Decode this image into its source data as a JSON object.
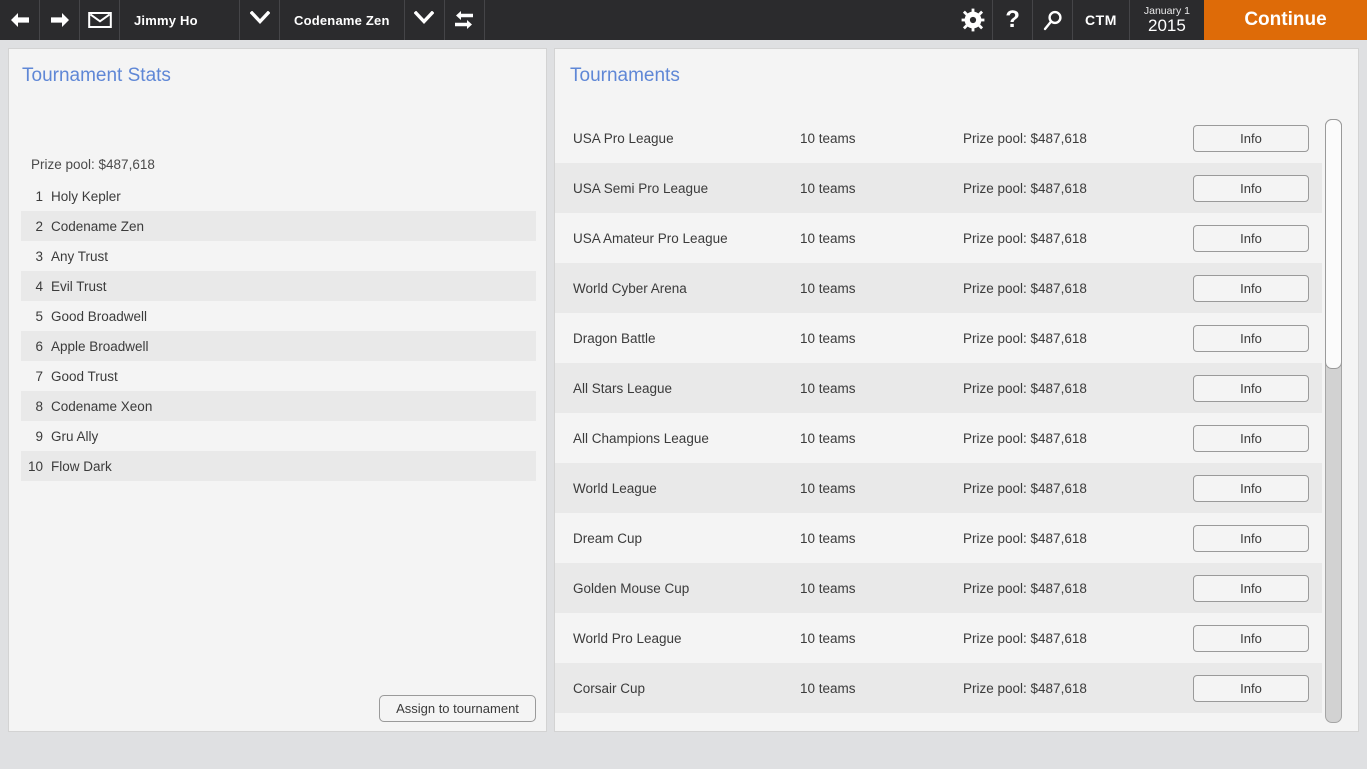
{
  "toolbar": {
    "back_icon": "arrow-left-icon",
    "forward_icon": "arrow-right-icon",
    "mail_icon": "envelope-icon",
    "user_name": "Jimmy Ho",
    "user_caret_icon": "chevron-down-icon",
    "team_name": "Codename Zen",
    "team_caret_icon": "chevron-down-icon",
    "swap_icon": "swap-arrows-icon",
    "settings_icon": "gear-icon",
    "help_icon": "question-mark-icon",
    "search_icon": "magnifier-icon",
    "ctm_label": "CTM",
    "date_top": "January 1",
    "date_bottom": "2015",
    "continue_label": "Continue",
    "accent_color": "#de6b08",
    "toolbar_color": "#2b2b2d"
  },
  "left_panel": {
    "title": "Tournament Stats",
    "prize_pool": "Prize pool: $487,618",
    "teams": [
      {
        "rank": "1",
        "name": "Holy Kepler"
      },
      {
        "rank": "2",
        "name": "Codename Zen"
      },
      {
        "rank": "3",
        "name": "Any Trust"
      },
      {
        "rank": "4",
        "name": "Evil Trust"
      },
      {
        "rank": "5",
        "name": "Good Broadwell"
      },
      {
        "rank": "6",
        "name": "Apple Broadwell"
      },
      {
        "rank": "7",
        "name": "Good Trust"
      },
      {
        "rank": "8",
        "name": "Codename Xeon"
      },
      {
        "rank": "9",
        "name": "Gru Ally"
      },
      {
        "rank": "10",
        "name": "Flow Dark"
      }
    ],
    "assign_label": "Assign to tournament"
  },
  "right_panel": {
    "title": "Tournaments",
    "info_label": "Info",
    "tournaments": [
      {
        "name": "USA Pro League",
        "teams": "10 teams",
        "prize": "Prize pool: $487,618"
      },
      {
        "name": "USA Semi Pro League",
        "teams": "10 teams",
        "prize": "Prize pool: $487,618"
      },
      {
        "name": "USA Amateur Pro League",
        "teams": "10 teams",
        "prize": "Prize pool: $487,618"
      },
      {
        "name": "World Cyber Arena",
        "teams": "10 teams",
        "prize": "Prize pool: $487,618"
      },
      {
        "name": "Dragon Battle",
        "teams": "10 teams",
        "prize": "Prize pool: $487,618"
      },
      {
        "name": "All Stars League",
        "teams": "10 teams",
        "prize": "Prize pool: $487,618"
      },
      {
        "name": "All Champions League",
        "teams": "10 teams",
        "prize": "Prize pool: $487,618"
      },
      {
        "name": "World League",
        "teams": "10 teams",
        "prize": "Prize pool: $487,618"
      },
      {
        "name": "Dream Cup",
        "teams": "10 teams",
        "prize": "Prize pool: $487,618"
      },
      {
        "name": "Golden Mouse Cup",
        "teams": "10 teams",
        "prize": "Prize pool: $487,618"
      },
      {
        "name": "World Pro League",
        "teams": "10 teams",
        "prize": "Prize pool: $487,618"
      },
      {
        "name": "Corsair Cup",
        "teams": "10 teams",
        "prize": "Prize pool: $487,618"
      }
    ]
  }
}
